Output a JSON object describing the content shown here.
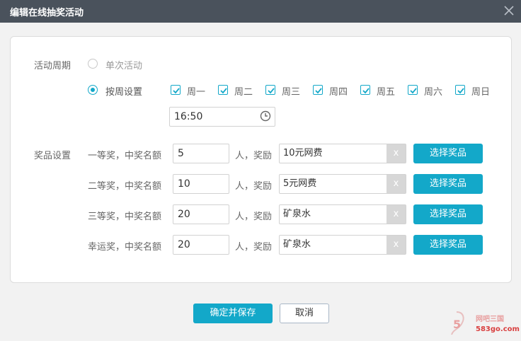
{
  "window": {
    "title": "编辑在线抽奖活动",
    "close_icon": "close-icon"
  },
  "period": {
    "label": "活动周期",
    "option_single": "单次活动",
    "option_weekly": "按周设置",
    "selected": "weekly",
    "weekdays": [
      {
        "label": "周一",
        "checked": true
      },
      {
        "label": "周二",
        "checked": true
      },
      {
        "label": "周三",
        "checked": true
      },
      {
        "label": "周四",
        "checked": true
      },
      {
        "label": "周五",
        "checked": true
      },
      {
        "label": "周六",
        "checked": true
      },
      {
        "label": "周日",
        "checked": true
      }
    ],
    "time": "16:50",
    "time_icon": "clock-icon"
  },
  "prizes": {
    "label": "奖品设置",
    "count_suffix": "人，奖励",
    "remove_label": "x",
    "select_label": "选择奖品",
    "rows": [
      {
        "name": "一等奖，中奖名额",
        "count": "5",
        "prize": "10元网费"
      },
      {
        "name": "二等奖，中奖名额",
        "count": "10",
        "prize": "5元网费"
      },
      {
        "name": "三等奖，中奖名额",
        "count": "20",
        "prize": "矿泉水"
      },
      {
        "name": "幸运奖，中奖名额",
        "count": "20",
        "prize": "矿泉水"
      }
    ]
  },
  "footer": {
    "save_label": "确定并保存",
    "cancel_label": "取消"
  },
  "watermark": {
    "name": "网吧三国",
    "url": "583go.com"
  },
  "colors": {
    "accent": "#13a8c9",
    "titlebar": "#4a525c"
  }
}
